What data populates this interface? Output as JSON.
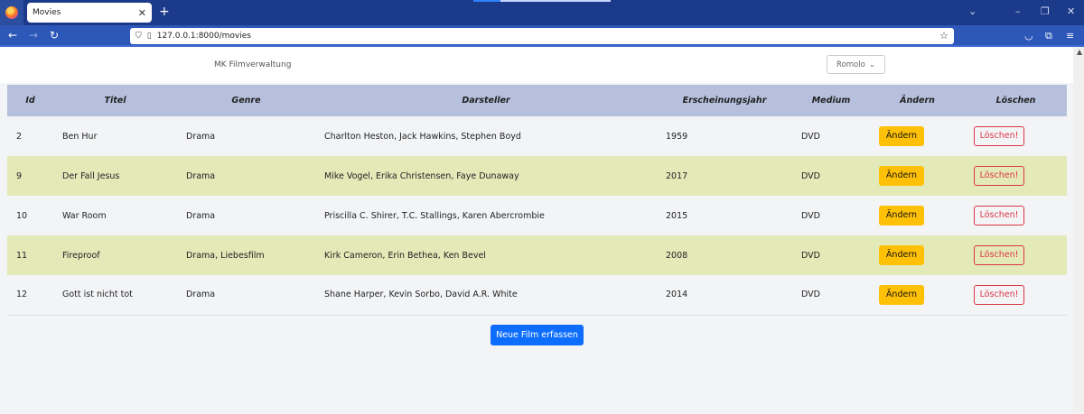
{
  "browser": {
    "tab_title": "Movies",
    "tab_close": "✕",
    "new_tab": "+",
    "url": "127.0.0.1:8000/movies"
  },
  "header": {
    "brand": "MK Filmverwaltung",
    "user": "Romolo"
  },
  "table": {
    "columns": [
      "Id",
      "Titel",
      "Genre",
      "Darsteller",
      "Erscheinungsjahr",
      "Medium",
      "Ändern",
      "Löschen"
    ],
    "rows": [
      {
        "id": "2",
        "title": "Ben Hur",
        "genre": "Drama",
        "cast": "Charlton Heston, Jack Hawkins, Stephen Boyd",
        "year": "1959",
        "medium": "DVD",
        "edit": "Ändern",
        "delete": "Löschen!"
      },
      {
        "id": "9",
        "title": "Der Fall Jesus",
        "genre": "Drama",
        "cast": "Mike Vogel, Erika Christensen, Faye Dunaway",
        "year": "2017",
        "medium": "DVD",
        "edit": "Ändern",
        "delete": "Löschen!"
      },
      {
        "id": "10",
        "title": "War Room",
        "genre": "Drama",
        "cast": "Priscilla C. Shirer, T.C. Stallings, Karen Abercrombie",
        "year": "2015",
        "medium": "DVD",
        "edit": "Ändern",
        "delete": "Löschen!"
      },
      {
        "id": "11",
        "title": "Fireproof",
        "genre": "Drama, Liebesfilm",
        "cast": "Kirk Cameron, Erin Bethea, Ken Bevel",
        "year": "2008",
        "medium": "DVD",
        "edit": "Ändern",
        "delete": "Löschen!"
      },
      {
        "id": "12",
        "title": "Gott ist nicht tot",
        "genre": "Drama",
        "cast": "Shane Harper, Kevin Sorbo, David A.R. White",
        "year": "2014",
        "medium": "DVD",
        "edit": "Ändern",
        "delete": "Löschen!"
      }
    ]
  },
  "actions": {
    "new_film": "Neue Film erfassen"
  }
}
